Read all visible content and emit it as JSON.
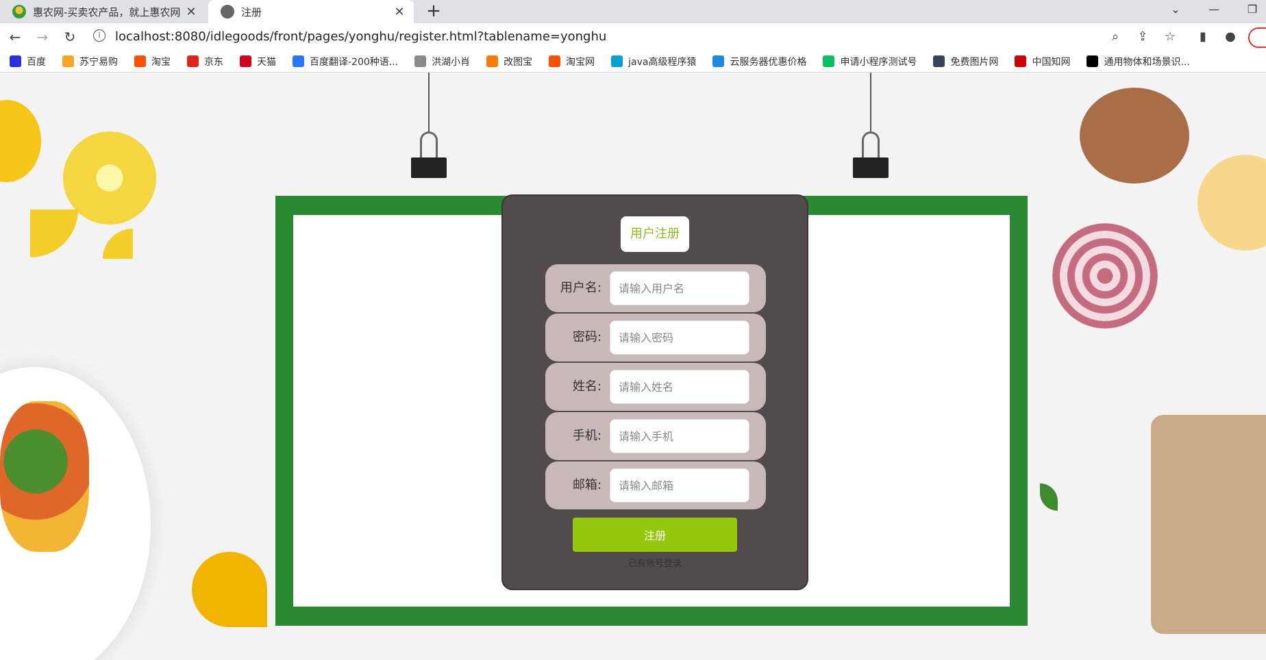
{
  "browser": {
    "tabs": [
      {
        "title": "惠农网-买卖农产品，就上惠农网",
        "active": false
      },
      {
        "title": "注册",
        "active": true
      }
    ],
    "new_tab_glyph": "+",
    "url": "localhost:8080/idlegoods/front/pages/yonghu/register.html?tablename=yonghu",
    "bookmarks": [
      {
        "label": "百度",
        "icon": "baidu-icon",
        "color": "#2932e1"
      },
      {
        "label": "苏宁易购",
        "icon": "suning-icon",
        "color": "#f5a623"
      },
      {
        "label": "淘宝",
        "icon": "taobao-icon",
        "color": "#ff5000"
      },
      {
        "label": "京东",
        "icon": "jd-icon",
        "color": "#e1251b"
      },
      {
        "label": "天猫",
        "icon": "tmall-icon",
        "color": "#d0021b"
      },
      {
        "label": "百度翻译-200种语...",
        "icon": "translate-icon",
        "color": "#2878ff"
      },
      {
        "label": "洪湖小肖",
        "icon": "bird-icon",
        "color": "#8a8a8a"
      },
      {
        "label": "改图宝",
        "icon": "gaitubao-icon",
        "color": "#ff7a00"
      },
      {
        "label": "淘宝网",
        "icon": "taobao-icon",
        "color": "#ff5000"
      },
      {
        "label": "java高级程序猿",
        "icon": "bilibili-icon",
        "color": "#00a1d6"
      },
      {
        "label": "云服务器优惠价格",
        "icon": "cloud-icon",
        "color": "#1e88e5"
      },
      {
        "label": "申请小程序测试号",
        "icon": "wechat-icon",
        "color": "#07c160"
      },
      {
        "label": "免费图片网",
        "icon": "tumblr-icon",
        "color": "#35465c"
      },
      {
        "label": "中国知网",
        "icon": "cnki-icon",
        "color": "#c00"
      },
      {
        "label": "通用物体和场景识...",
        "icon": "ai-icon",
        "color": "#000"
      }
    ]
  },
  "form": {
    "title": "用户注册",
    "fields": [
      {
        "label": "用户名:",
        "placeholder": "请输入用户名",
        "value": ""
      },
      {
        "label": "密码:",
        "placeholder": "请输入密码",
        "value": ""
      },
      {
        "label": "姓名:",
        "placeholder": "请输入姓名",
        "value": ""
      },
      {
        "label": "手机:",
        "placeholder": "请输入手机",
        "value": ""
      },
      {
        "label": "邮箱:",
        "placeholder": "请输入邮箱",
        "value": ""
      }
    ],
    "submit_label": "注册",
    "login_link": "已有账号登录"
  },
  "colors": {
    "board_green": "#2a8a32",
    "panel_bg": "#514b4b",
    "row_bg": "#c9b8b8",
    "accent_green": "#95c80c",
    "title_text": "#8dbc1e"
  }
}
